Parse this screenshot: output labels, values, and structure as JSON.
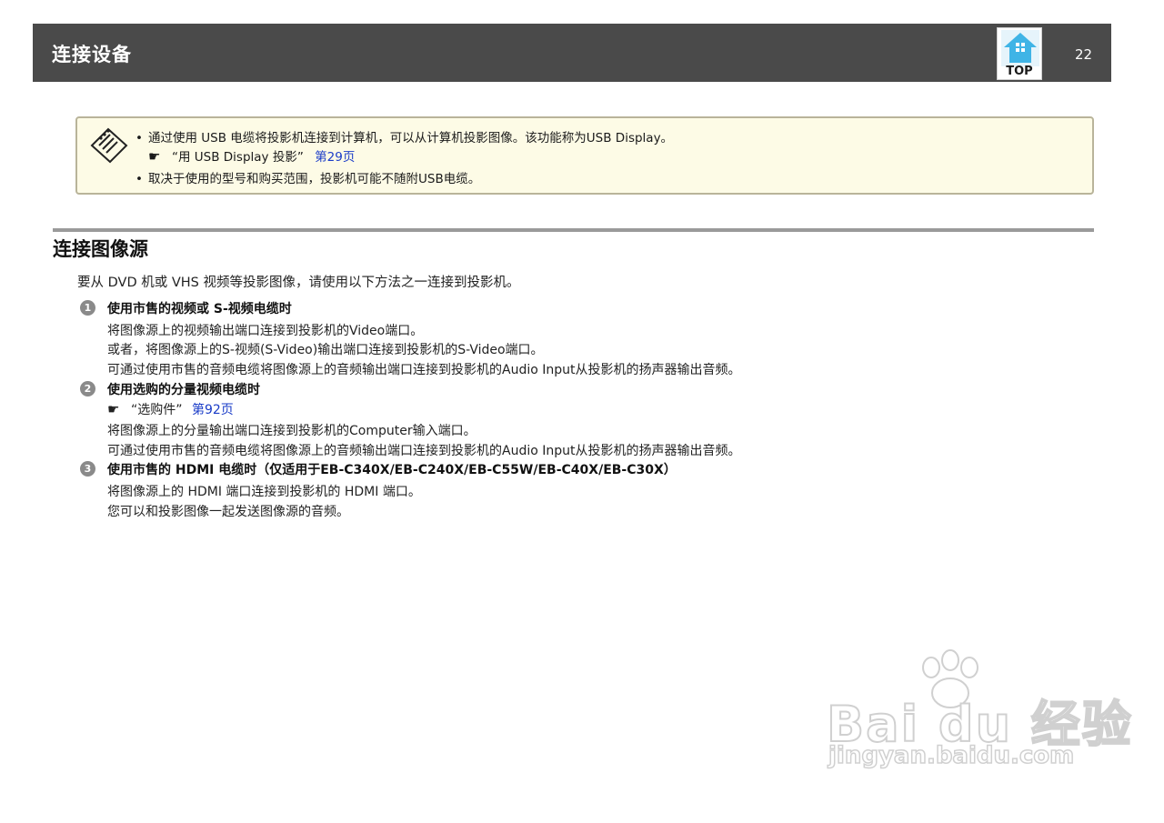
{
  "header": {
    "title": "连接设备",
    "top_label": "TOP",
    "page_number": "22"
  },
  "note": {
    "line1": "通过使用 USB 电缆将投影机连接到计算机，可以从计算机投影图像。该功能称为USB Display。",
    "line2_ref_mark": "☛",
    "line2_text": "“用 USB Display 投影”",
    "line2_link": "第29页",
    "line3": "取决于使用的型号和购买范围，投影机可能不随附USB电缆。",
    "bullet": "•"
  },
  "section": {
    "title": "连接图像源",
    "intro": "要从 DVD 机或 VHS 视频等投影图像，请使用以下方法之一连接到投影机。",
    "items": [
      {
        "number": "1",
        "heading": "使用市售的视频或 S-视频电缆时",
        "lines": [
          "将图像源上的视频输出端口连接到投影机的Video端口。",
          "或者，将图像源上的S-视频(S-Video)输出端口连接到投影机的S-Video端口。",
          "可通过使用市售的音频电缆将图像源上的音频输出端口连接到投影机的Audio Input从投影机的扬声器输出音频。"
        ]
      },
      {
        "number": "2",
        "heading": "使用选购的分量视频电缆时",
        "ref_mark": "☛",
        "ref_text": "“选购件”",
        "ref_link": "第92页",
        "lines": [
          "将图像源上的分量输出端口连接到投影机的Computer输入端口。",
          "可通过使用市售的音频电缆将图像源上的音频输出端口连接到投影机的Audio Input从投影机的扬声器输出音频。"
        ]
      },
      {
        "number": "3",
        "heading": "使用市售的 HDMI 电缆时（仅适用于EB-C340X/EB-C240X/EB-C55W/EB-C40X/EB-C30X）",
        "lines": [
          "将图像源上的 HDMI 端口连接到投影机的 HDMI 端口。",
          "您可以和投影图像一起发送图像源的音频。"
        ]
      }
    ]
  },
  "watermark": {
    "brand": "Bai du 经验",
    "url": "jingyan.baidu.com"
  },
  "colors": {
    "header_bg": "#4a4a4a",
    "note_bg": "#fdfbe6",
    "link": "#1a3cc8"
  }
}
